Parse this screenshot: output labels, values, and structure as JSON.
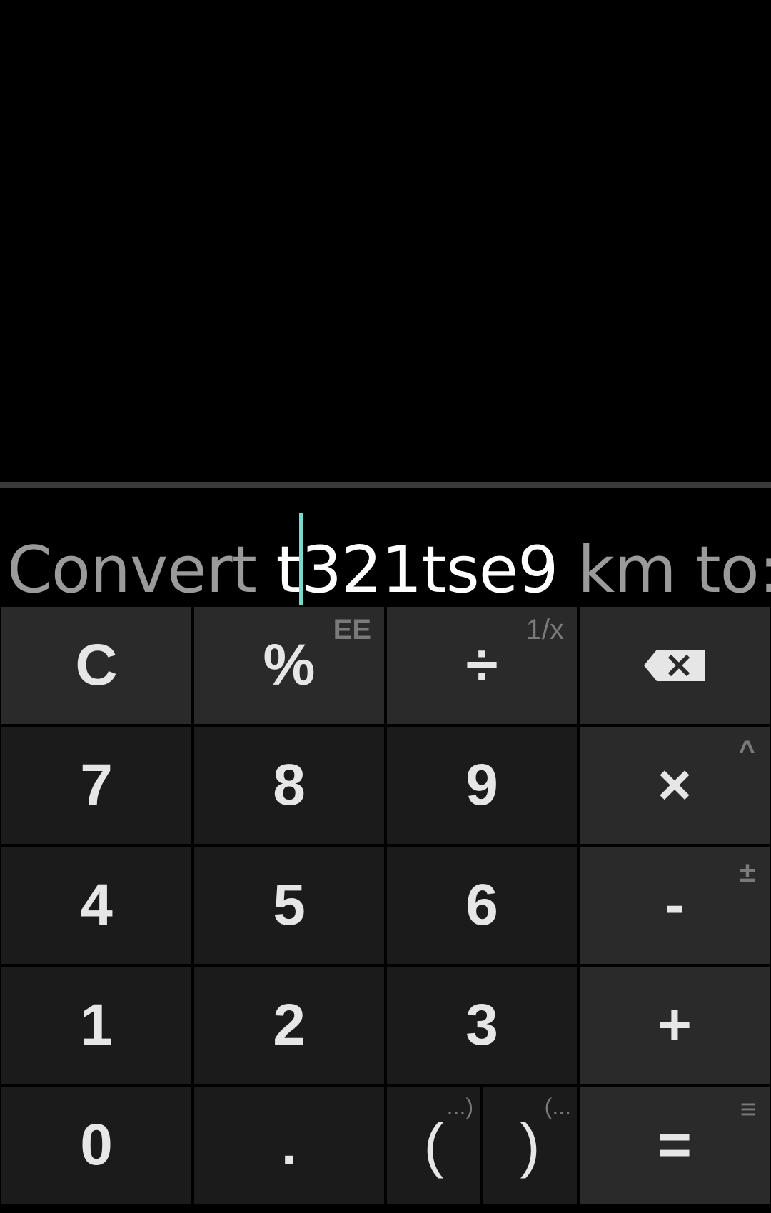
{
  "display": {
    "prefix": "Convert ",
    "typed_before_cursor": "t",
    "typed_after_cursor": "321tse9",
    "suffix": " km to:"
  },
  "keys": {
    "clear": "C",
    "percent": "%",
    "percent_alt": "EE",
    "divide": "÷",
    "divide_alt": "1/x",
    "seven": "7",
    "eight": "8",
    "nine": "9",
    "multiply": "×",
    "multiply_alt": "^",
    "four": "4",
    "five": "5",
    "six": "6",
    "minus": "-",
    "minus_alt": "±",
    "one": "1",
    "two": "2",
    "three": "3",
    "plus": "+",
    "zero": "0",
    "decimal": ".",
    "open_paren": "(",
    "open_paren_alt": "...)",
    "close_paren": ")",
    "close_paren_alt": "(...",
    "equals": "=",
    "equals_alt": "≡"
  },
  "icons": {
    "backspace": "backspace-icon"
  },
  "colors": {
    "background": "#000000",
    "key_top_row": "#2a2a2a",
    "key_digit": "#1b1b1b",
    "cursor": "#7fd6cc"
  }
}
